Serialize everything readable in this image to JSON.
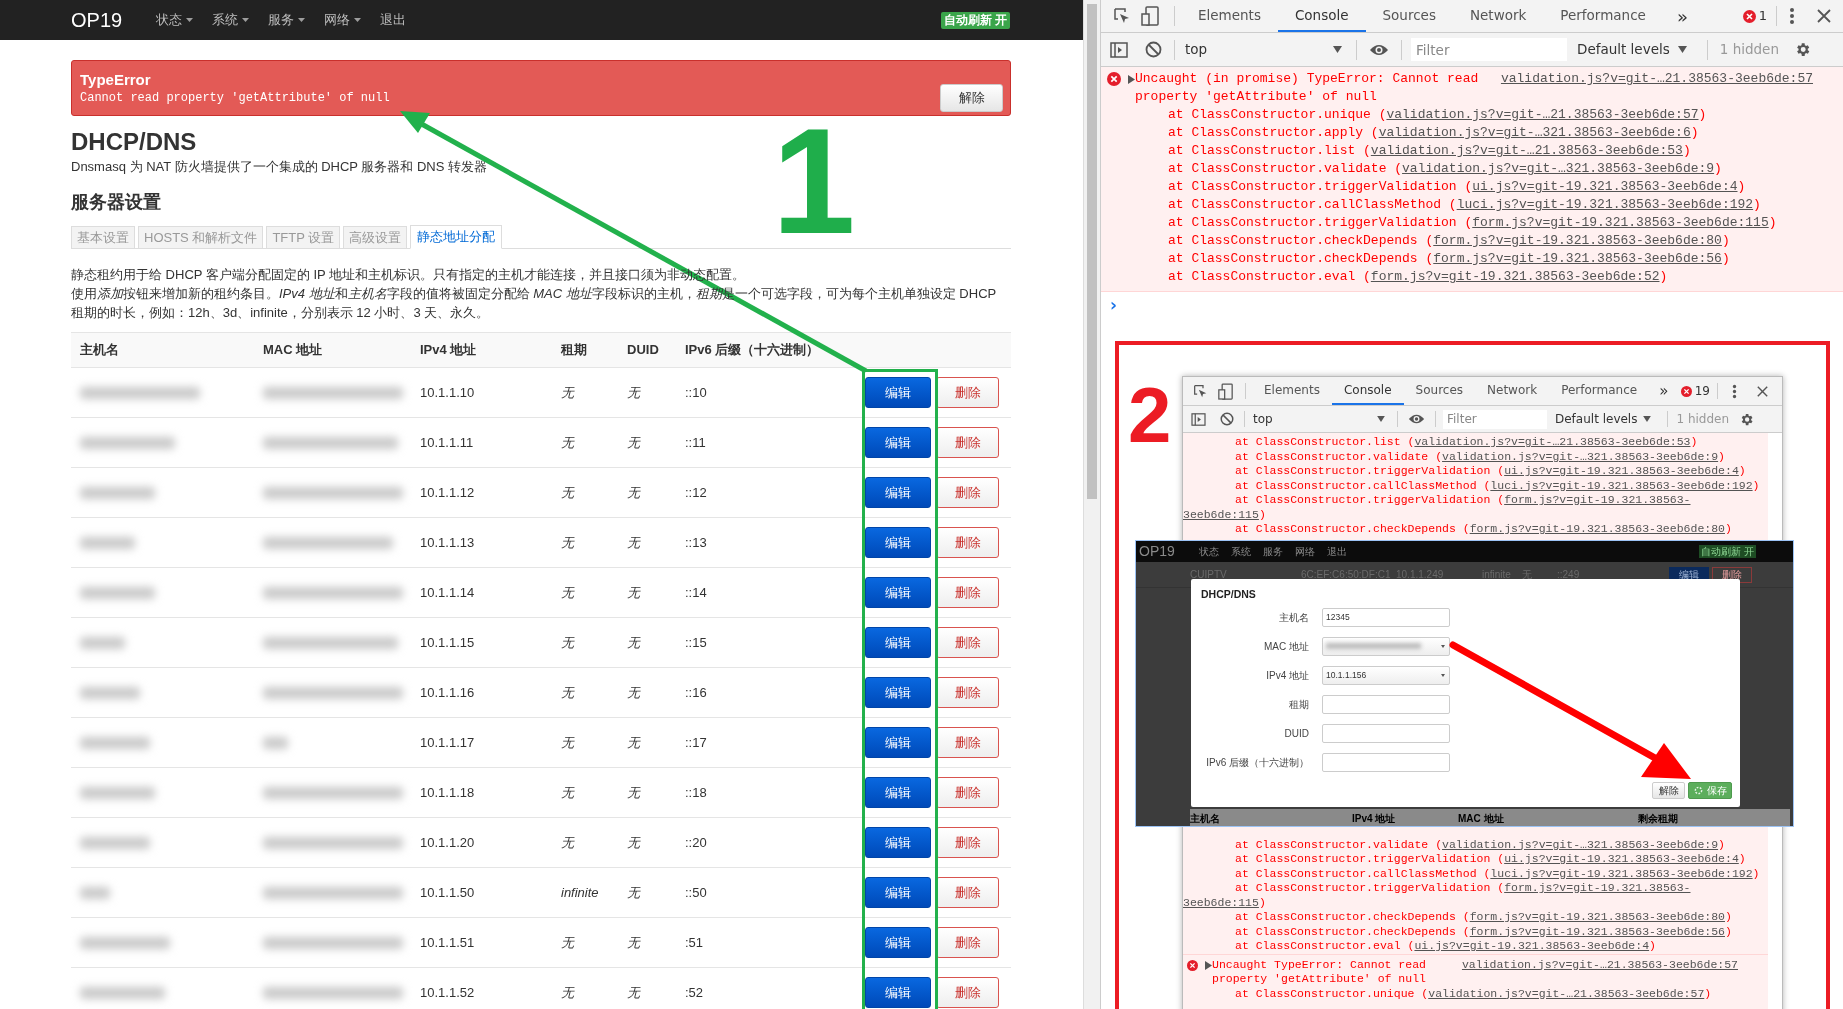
{
  "page": {
    "brand": "OP19",
    "nav": [
      {
        "label": "状态",
        "dropdown": true
      },
      {
        "label": "系统",
        "dropdown": true
      },
      {
        "label": "服务",
        "dropdown": true
      },
      {
        "label": "网络",
        "dropdown": true
      },
      {
        "label": "退出",
        "dropdown": false
      }
    ],
    "auto_refresh": "自动刷新 开",
    "alert": {
      "title": "TypeError",
      "message": "Cannot read property 'getAttribute' of null",
      "button": "解除"
    },
    "title": "DHCP/DNS",
    "subtitle": "Dnsmasq 为 NAT 防火墙提供了一个集成的 DHCP 服务器和 DNS 转发器",
    "section": "服务器设置",
    "tabs": [
      {
        "label": "基本设置",
        "selected": false
      },
      {
        "label": "HOSTS 和解析文件",
        "selected": false
      },
      {
        "label": "TFTP 设置",
        "selected": false
      },
      {
        "label": "高级设置",
        "selected": false
      },
      {
        "label": "静态地址分配",
        "selected": true
      }
    ],
    "description": [
      [
        {
          "text": "静态租约用于给 DHCP 客户端分配固定的 IP 地址和主机标识。只有指定的主机才能连接，并且接口须为非动态配置。",
          "italic": false
        }
      ],
      [
        {
          "text": "使用",
          "italic": false
        },
        {
          "text": "添加",
          "italic": true
        },
        {
          "text": "按钮来增加新的租约条目。",
          "italic": false
        },
        {
          "text": "IPv4 地址",
          "italic": true
        },
        {
          "text": "和",
          "italic": false
        },
        {
          "text": "主机名",
          "italic": true
        },
        {
          "text": "字段的值将被固定分配给 ",
          "italic": false
        },
        {
          "text": "MAC 地址",
          "italic": true
        },
        {
          "text": "字段标识的主机，",
          "italic": false
        },
        {
          "text": "租期",
          "italic": true
        },
        {
          "text": "是一个可选字段，可为每个主机单独设定 DHCP 租期的时长，例如：12h、3d、infinite，分别表示 12 小时、3 天、永久。",
          "italic": false
        }
      ]
    ],
    "table": {
      "columns": [
        "主机名",
        "MAC 地址",
        "IPv4 地址",
        "租期",
        "DUID",
        "IPv6 后缀（十六进制）"
      ],
      "rows": [
        {
          "ipv4": "10.1.1.10",
          "lease": "无",
          "duid": "无",
          "ipv6": "::10",
          "edit": "编辑",
          "delete": "删除"
        },
        {
          "ipv4": "10.1.1.11",
          "lease": "无",
          "duid": "无",
          "ipv6": "::11",
          "edit": "编辑",
          "delete": "删除"
        },
        {
          "ipv4": "10.1.1.12",
          "lease": "无",
          "duid": "无",
          "ipv6": "::12",
          "edit": "编辑",
          "delete": "删除"
        },
        {
          "ipv4": "10.1.1.13",
          "lease": "无",
          "duid": "无",
          "ipv6": "::13",
          "edit": "编辑",
          "delete": "删除"
        },
        {
          "ipv4": "10.1.1.14",
          "lease": "无",
          "duid": "无",
          "ipv6": "::14",
          "edit": "编辑",
          "delete": "删除"
        },
        {
          "ipv4": "10.1.1.15",
          "lease": "无",
          "duid": "无",
          "ipv6": "::15",
          "edit": "编辑",
          "delete": "删除"
        },
        {
          "ipv4": "10.1.1.16",
          "lease": "无",
          "duid": "无",
          "ipv6": "::16",
          "edit": "编辑",
          "delete": "删除"
        },
        {
          "ipv4": "10.1.1.17",
          "lease": "无",
          "duid": "无",
          "ipv6": "::17",
          "edit": "编辑",
          "delete": "删除"
        },
        {
          "ipv4": "10.1.1.18",
          "lease": "无",
          "duid": "无",
          "ipv6": "::18",
          "edit": "编辑",
          "delete": "删除"
        },
        {
          "ipv4": "10.1.1.20",
          "lease": "无",
          "duid": "无",
          "ipv6": "::20",
          "edit": "编辑",
          "delete": "删除"
        },
        {
          "ipv4": "10.1.1.50",
          "lease": "infinite",
          "duid": "无",
          "ipv6": "::50",
          "edit": "编辑",
          "delete": "删除"
        },
        {
          "ipv4": "10.1.1.51",
          "lease": "无",
          "duid": "无",
          "ipv6": ":51",
          "edit": "编辑",
          "delete": "删除"
        },
        {
          "ipv4": "10.1.1.52",
          "lease": "无",
          "duid": "无",
          "ipv6": ":52",
          "edit": "编辑",
          "delete": "删除"
        }
      ]
    }
  },
  "annotations": {
    "step_1": "1",
    "step_2": "2"
  },
  "devtools": {
    "tabs": [
      {
        "label": "Elements",
        "selected": false
      },
      {
        "label": "Console",
        "selected": true
      },
      {
        "label": "Sources",
        "selected": false
      },
      {
        "label": "Network",
        "selected": false
      },
      {
        "label": "Performance",
        "selected": false
      }
    ],
    "more": "»",
    "error_count": "1",
    "context": "top",
    "filter_placeholder": "Filter",
    "levels": "Default levels",
    "hidden": "1 hidden",
    "error": {
      "message": "Uncaught (in promise) TypeError: Cannot read property 'getAttribute' of null",
      "link": "validation.js?v=git-…21.38563-3eeb6de:57",
      "frames": [
        {
          "call": "at ClassConstructor.unique (",
          "link": "validation.js?v=git-…21.38563-3eeb6de:57",
          "close": ")"
        },
        {
          "call": "at ClassConstructor.apply (",
          "link": "validation.js?v=git-…321.38563-3eeb6de:6",
          "close": ")"
        },
        {
          "call": "at ClassConstructor.list (",
          "link": "validation.js?v=git-…21.38563-3eeb6de:53",
          "close": ")"
        },
        {
          "call": "at ClassConstructor.validate (",
          "link": "validation.js?v=git-…321.38563-3eeb6de:9",
          "close": ")"
        },
        {
          "call": "at ClassConstructor.triggerValidation (",
          "link": "ui.js?v=git-19.321.38563-3eeb6de:4",
          "close": ")"
        },
        {
          "call": "at ClassConstructor.callClassMethod (",
          "link": "luci.js?v=git-19.321.38563-3eeb6de:192",
          "close": ")"
        },
        {
          "call": "at ClassConstructor.triggerValidation (",
          "link": "form.js?v=git-19.321.38563-3eeb6de:115",
          "close": ")"
        },
        {
          "call": "at ClassConstructor.checkDepends (",
          "link": "form.js?v=git-19.321.38563-3eeb6de:80",
          "close": ")"
        },
        {
          "call": "at ClassConstructor.checkDepends (",
          "link": "form.js?v=git-19.321.38563-3eeb6de:56",
          "close": ")"
        },
        {
          "call": "at ClassConstructor.eval (",
          "link": "form.js?v=git-19.321.38563-3eeb6de:52",
          "close": ")"
        }
      ]
    },
    "prompt": "›",
    "inset": {
      "tabs": [
        {
          "label": "Elements",
          "selected": false
        },
        {
          "label": "Console",
          "selected": true
        },
        {
          "label": "Sources",
          "selected": false
        },
        {
          "label": "Network",
          "selected": false
        },
        {
          "label": "Performance",
          "selected": false
        }
      ],
      "more": "»",
      "error_count": "19",
      "context": "top",
      "filter_placeholder": "Filter",
      "levels": "Default levels",
      "hidden": "1 hidden",
      "frames_top": [
        {
          "call": "at ClassConstructor.list (",
          "link": "validation.js?v=git-…21.38563-3eeb6de:53",
          "close": ")"
        },
        {
          "call": "at ClassConstructor.validate (",
          "link": "validation.js?v=git-…321.38563-3eeb6de:9",
          "close": ")"
        },
        {
          "call": "at ClassConstructor.triggerValidation (",
          "link": "ui.js?v=git-19.321.38563-3eeb6de:4",
          "close": ")"
        },
        {
          "call": "at ClassConstructor.callClassMethod (",
          "link": "luci.js?v=git-19.321.38563-3eeb6de:192",
          "close": ")"
        },
        {
          "call": "at ClassConstructor.triggerValidation (",
          "link": "form.js?v=git-19.321.38563-",
          "cont": "3eeb6de:115",
          "close": ")"
        },
        {
          "call": "at ClassConstructor.checkDepends (",
          "link": "form.js?v=git-19.321.38563-3eeb6de:80",
          "close": ")"
        }
      ],
      "frames_bottom": [
        {
          "call": "at ClassConstructor.validate (",
          "link": "validation.js?v=git-…321.38563-3eeb6de:9",
          "close": ")"
        },
        {
          "call": "at ClassConstructor.triggerValidation (",
          "link": "ui.js?v=git-19.321.38563-3eeb6de:4",
          "close": ")"
        },
        {
          "call": "at ClassConstructor.callClassMethod (",
          "link": "luci.js?v=git-19.321.38563-3eeb6de:192",
          "close": ")"
        },
        {
          "call": "at ClassConstructor.triggerValidation (",
          "link": "form.js?v=git-19.321.38563-",
          "cont": "3eeb6de:115",
          "close": ")"
        },
        {
          "call": "at ClassConstructor.checkDepends (",
          "link": "form.js?v=git-19.321.38563-3eeb6de:80",
          "close": ")"
        },
        {
          "call": "at ClassConstructor.checkDepends (",
          "link": "form.js?v=git-19.321.38563-3eeb6de:56",
          "close": ")"
        },
        {
          "call": "at ClassConstructor.eval (",
          "link": "ui.js?v=git-19.321.38563-3eeb6de:4",
          "close": ")"
        }
      ],
      "error2": {
        "message": "Uncaught TypeError: Cannot read property 'getAttribute' of null",
        "link": "validation.js?v=git-…21.38563-3eeb6de:57",
        "frames": [
          {
            "call": "at ClassConstructor.unique (",
            "link": "validation.js?v=git-…21.38563-3eeb6de:57",
            "close": ")"
          }
        ]
      },
      "screenshot": {
        "brand": "OP19",
        "nav": [
          "状态",
          "系统",
          "服务",
          "网络",
          "退出"
        ],
        "auto_refresh": "自动刷新 开",
        "row": [
          "CUIPTV",
          "6C:EF:C6:50:DF:C1",
          "10.1.1.249",
          "infinite",
          "无",
          "::249"
        ],
        "row_buttons": [
          "编辑",
          "删除"
        ],
        "modal": {
          "title": "DHCP/DNS",
          "fields": [
            {
              "label": "主机名",
              "kind": "text",
              "value": "12345"
            },
            {
              "label": "MAC 地址",
              "kind": "select_blurred"
            },
            {
              "label": "IPv4 地址",
              "kind": "select",
              "value": "10.1.1.156"
            },
            {
              "label": "租期",
              "kind": "text"
            },
            {
              "label": "DUID",
              "kind": "text"
            },
            {
              "label": "IPv6 后缀（十六进制）",
              "kind": "text"
            }
          ],
          "dismiss": "解除",
          "save": "保存"
        },
        "columns": [
          "主机名",
          "IPv4 地址",
          "MAC 地址",
          "剩余租期"
        ]
      }
    }
  }
}
